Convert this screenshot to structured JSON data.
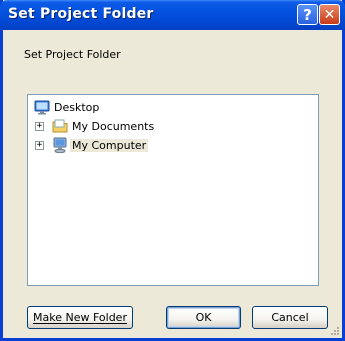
{
  "window": {
    "title": "Set Project Folder"
  },
  "dialog": {
    "description": "Set Project Folder"
  },
  "tree": {
    "root": {
      "label": "Desktop",
      "icon": "desktop-icon"
    },
    "items": [
      {
        "label": "My Documents",
        "icon": "folder-icon",
        "expander": "+",
        "selected": false
      },
      {
        "label": "My Computer",
        "icon": "computer-icon",
        "expander": "+",
        "selected": true
      }
    ]
  },
  "buttons": {
    "make_new_folder": "Make New Folder",
    "ok": "OK",
    "cancel": "Cancel"
  },
  "titlebar_buttons": {
    "help": "?",
    "close": "✕"
  },
  "colors": {
    "titlebar": "#0352e0",
    "dialog_bg": "#ece9d8",
    "border": "#7f9db9"
  }
}
